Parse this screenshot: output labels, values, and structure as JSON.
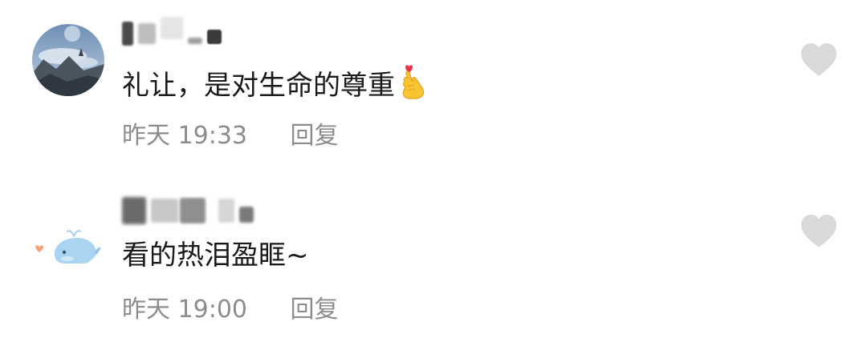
{
  "comments": [
    {
      "text": "礼让，是对生命的尊重",
      "emoji_name": "finger-heart-icon",
      "time": "昨天 19:33",
      "reply_label": "回复",
      "avatar_name": "avatar-mountain-sky",
      "like_icon": "heart-icon"
    },
    {
      "text": "看的热泪盈眶~",
      "time": "昨天 19:00",
      "reply_label": "回复",
      "avatar_name": "avatar-whale",
      "like_icon": "heart-icon"
    }
  ],
  "colors": {
    "text": "#1a1a1a",
    "meta": "#8c8c8c",
    "like": "#d9d9d9",
    "background": "#ffffff"
  }
}
